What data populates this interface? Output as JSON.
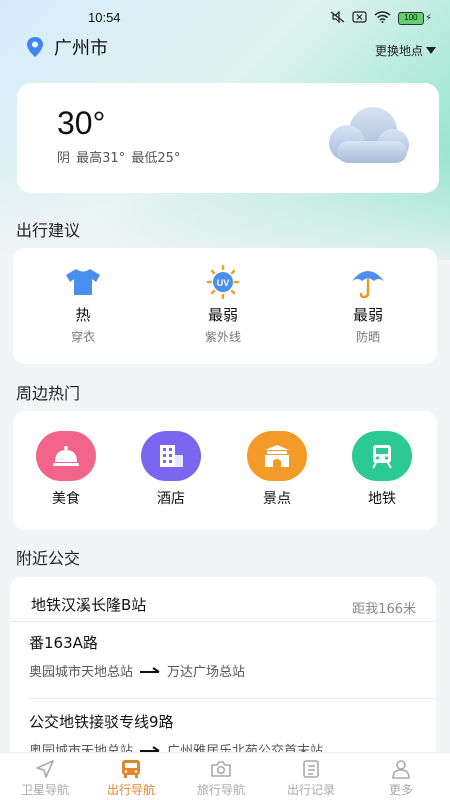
{
  "status_bar": {
    "time": "10:54",
    "battery": "100"
  },
  "location": {
    "city": "广州市",
    "change_label": "更换地点"
  },
  "weather": {
    "temperature": "30°",
    "condition": "阴",
    "high": "最高31°",
    "low": "最低25°",
    "icon": "cloud-icon"
  },
  "advice": {
    "title": "出行建议",
    "items": [
      {
        "value": "热",
        "label": "穿衣",
        "icon": "shirt-icon",
        "color": "#4a8ef0"
      },
      {
        "value": "最弱",
        "label": "紫外线",
        "icon": "uv-icon",
        "color": "#f0a323",
        "icon_text": "UV"
      },
      {
        "value": "最弱",
        "label": "防晒",
        "icon": "umbrella-icon",
        "color": "#4a8ef0"
      }
    ]
  },
  "hot": {
    "title": "周边热门",
    "items": [
      {
        "label": "美食",
        "icon": "food-cloche-icon",
        "color": "#f2648a"
      },
      {
        "label": "酒店",
        "icon": "hotel-icon",
        "color": "#7b66f0"
      },
      {
        "label": "景点",
        "icon": "gate-icon",
        "color": "#f39a28"
      },
      {
        "label": "地铁",
        "icon": "subway-icon",
        "color": "#2cc995"
      }
    ]
  },
  "bus": {
    "title": "附近公交",
    "station": "地铁汉溪长隆B站",
    "distance": "距我166米",
    "routes": [
      {
        "name": "番163A路",
        "from": "奥园城市天地总站",
        "to": "万达广场总站"
      },
      {
        "name": "公交地铁接驳专线9路",
        "from": "奥园城市天地总站",
        "to": "广州雅居乐北苑公交首末站"
      }
    ]
  },
  "nav": {
    "items": [
      {
        "label": "卫星导航",
        "icon": "navigation-arrow-icon",
        "active": false
      },
      {
        "label": "出行导航",
        "icon": "bus-icon",
        "active": true
      },
      {
        "label": "旅行导航",
        "icon": "camera-icon",
        "active": false
      },
      {
        "label": "出行记录",
        "icon": "notes-icon",
        "active": false
      },
      {
        "label": "更多",
        "icon": "person-icon",
        "active": false
      }
    ]
  }
}
